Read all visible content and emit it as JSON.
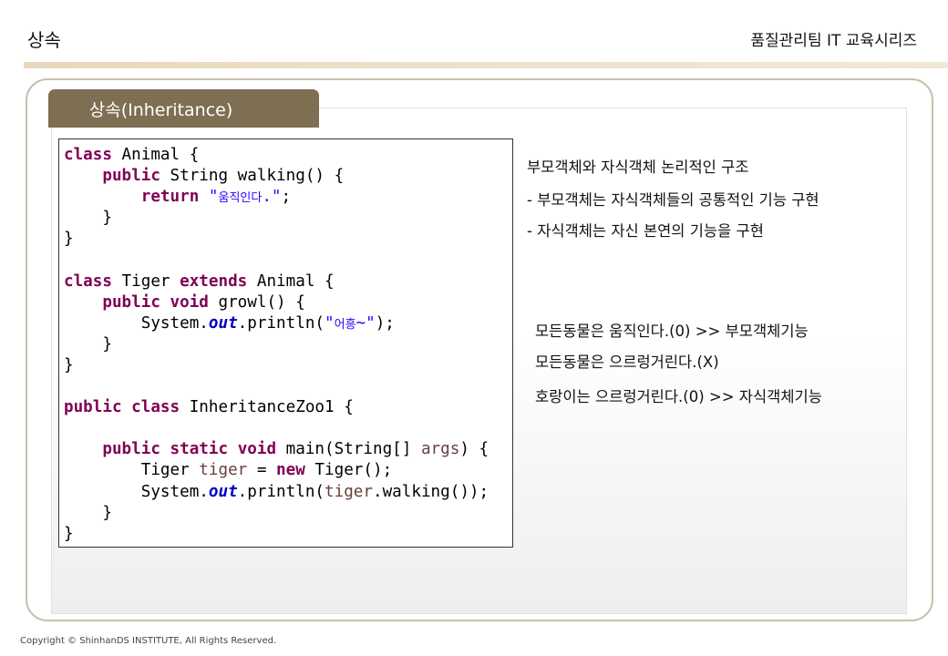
{
  "header": {
    "title": "상속",
    "series": "품질관리팀 IT 교육시리즈"
  },
  "tab": {
    "label": "상속(Inheritance)"
  },
  "code": {
    "lines": [
      [
        {
          "t": "class",
          "c": "kw"
        },
        {
          "t": " Animal {"
        }
      ],
      [
        {
          "t": "    "
        },
        {
          "t": "public",
          "c": "kw"
        },
        {
          "t": " String walking() {"
        }
      ],
      [
        {
          "t": "        "
        },
        {
          "t": "return",
          "c": "kw"
        },
        {
          "t": " "
        },
        {
          "t": "\"",
          "c": "str"
        },
        {
          "t": "움직인다",
          "c": "str-ko"
        },
        {
          "t": ".\"",
          "c": "str"
        },
        {
          "t": ";"
        }
      ],
      [
        {
          "t": "    }"
        }
      ],
      [
        {
          "t": "}"
        }
      ],
      [
        {
          "t": ""
        }
      ],
      [
        {
          "t": "class",
          "c": "kw"
        },
        {
          "t": " Tiger "
        },
        {
          "t": "extends",
          "c": "kw"
        },
        {
          "t": " Animal {"
        }
      ],
      [
        {
          "t": "    "
        },
        {
          "t": "public",
          "c": "kw"
        },
        {
          "t": " "
        },
        {
          "t": "void",
          "c": "kw"
        },
        {
          "t": " growl() {"
        }
      ],
      [
        {
          "t": "        System."
        },
        {
          "t": "out",
          "c": "fld"
        },
        {
          "t": ".println("
        },
        {
          "t": "\"",
          "c": "str"
        },
        {
          "t": "어흥",
          "c": "str-ko"
        },
        {
          "t": "~\"",
          "c": "str"
        },
        {
          "t": ");"
        }
      ],
      [
        {
          "t": "    }"
        }
      ],
      [
        {
          "t": "}"
        }
      ],
      [
        {
          "t": ""
        }
      ],
      [
        {
          "t": "public",
          "c": "kw"
        },
        {
          "t": " "
        },
        {
          "t": "class",
          "c": "kw"
        },
        {
          "t": " InheritanceZoo1 {"
        }
      ],
      [
        {
          "t": ""
        }
      ],
      [
        {
          "t": "    "
        },
        {
          "t": "public",
          "c": "kw"
        },
        {
          "t": " "
        },
        {
          "t": "static",
          "c": "kw"
        },
        {
          "t": " "
        },
        {
          "t": "void",
          "c": "kw"
        },
        {
          "t": " main(String[] "
        },
        {
          "t": "args",
          "c": "var"
        },
        {
          "t": ") {"
        }
      ],
      [
        {
          "t": "        Tiger "
        },
        {
          "t": "tiger",
          "c": "var"
        },
        {
          "t": " = "
        },
        {
          "t": "new",
          "c": "kw"
        },
        {
          "t": " Tiger();"
        }
      ],
      [
        {
          "t": "        System."
        },
        {
          "t": "out",
          "c": "fld"
        },
        {
          "t": ".println("
        },
        {
          "t": "tiger",
          "c": "var"
        },
        {
          "t": ".walking());"
        }
      ],
      [
        {
          "t": "    }"
        }
      ],
      [
        {
          "t": "}"
        }
      ]
    ]
  },
  "description": {
    "heading": "부모객체와 자식객체 논리적인 구조",
    "bullets": [
      "- 부모객체는 자식객체들의 공통적인 기능 구현",
      "- 자식객체는 자신 본연의 기능을 구현"
    ]
  },
  "examples": [
    "모든동물은 움직인다.(0)  >> 부모객체기능",
    "모든동물은 으르렁거린다.(X)",
    "호랑이는 으르렁거린다.(0) >> 자식객체기능"
  ],
  "footer": {
    "copyright": "Copyright © ShinhanDS INSTITUTE, All Rights Reserved."
  }
}
